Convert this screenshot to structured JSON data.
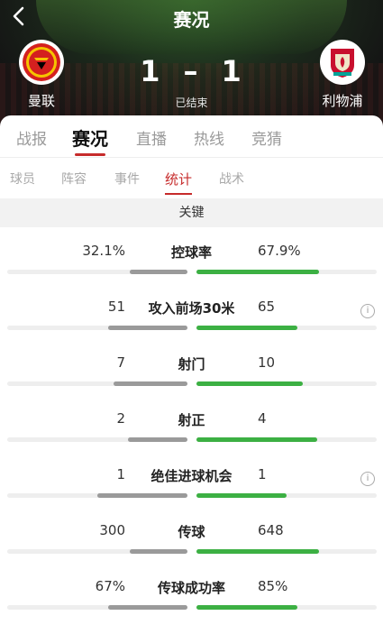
{
  "header": {
    "title": "赛况",
    "home_team": "曼联",
    "away_team": "利物浦",
    "home_score": "1",
    "away_score": "1",
    "separator": "–",
    "status": "已结束"
  },
  "tabs": [
    "战报",
    "赛况",
    "直播",
    "热线",
    "竞猜"
  ],
  "active_tab": "赛况",
  "subtabs": [
    "球员",
    "阵容",
    "事件",
    "统计",
    "战术"
  ],
  "active_subtab": "统计",
  "section_title": "关键",
  "stats": [
    {
      "name": "控球率",
      "home": "32.1%",
      "away": "67.9%",
      "home_share": 0.321,
      "away_share": 0.679,
      "info": false
    },
    {
      "name": "攻入前场30米",
      "home": "51",
      "away": "65",
      "home_share": 0.44,
      "away_share": 0.56,
      "info": true
    },
    {
      "name": "射门",
      "home": "7",
      "away": "10",
      "home_share": 0.41,
      "away_share": 0.59,
      "info": false
    },
    {
      "name": "射正",
      "home": "2",
      "away": "4",
      "home_share": 0.33,
      "away_share": 0.67,
      "info": false
    },
    {
      "name": "绝佳进球机会",
      "home": "1",
      "away": "1",
      "home_share": 0.5,
      "away_share": 0.5,
      "info": true
    },
    {
      "name": "传球",
      "home": "300",
      "away": "648",
      "home_share": 0.32,
      "away_share": 0.68,
      "info": false
    },
    {
      "name": "传球成功率",
      "home": "67%",
      "away": "85%",
      "home_share": 0.44,
      "away_share": 0.56,
      "info": false
    }
  ],
  "colors": {
    "accent": "#c62b2b",
    "home_bar": "#9a9a9a",
    "away_bar": "#3cb043"
  },
  "icons": {
    "back": "chevron-left-icon",
    "info": "info-circle-icon",
    "home_crest": "man-utd-crest-icon",
    "away_crest": "liverpool-crest-icon"
  }
}
